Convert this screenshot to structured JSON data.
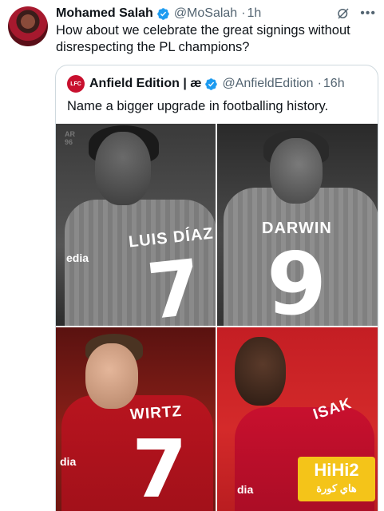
{
  "tweet": {
    "author_name": "Mohamed Salah",
    "handle": "@MoSalah",
    "separator": "·",
    "time": "1h",
    "text": "How about we celebrate the great signings without disrespecting the PL champions?",
    "icons": [
      "verified-badge-icon",
      "grok-icon",
      "more-options-icon"
    ],
    "more_options_glyph": "•••"
  },
  "quote": {
    "avatar_text": "LFC",
    "author_name": "Anfield Edition | æ",
    "handle": "@AnfieldEdition",
    "separator": "·",
    "time": "16h",
    "text": "Name a bigger upgrade in footballing history.",
    "image": {
      "corner_mark": "AR\n96",
      "panels": [
        {
          "player_name": "LUIS DÍAZ",
          "number": "7",
          "sponsor": "edia"
        },
        {
          "player_name": "DARWIN",
          "number": "9",
          "sponsor": ""
        },
        {
          "player_name": "WIRTZ",
          "number": "7",
          "sponsor": "dia"
        },
        {
          "player_name": "ISAK",
          "number": "",
          "sponsor": "dia"
        }
      ]
    }
  },
  "watermark": {
    "main": "HiHi2",
    "sub": "هاي كورة"
  },
  "colors": {
    "verified": "#1d9bf0",
    "text_primary": "#0f1419",
    "text_secondary": "#536471",
    "liverpool_red": "#c8102e",
    "watermark_yellow": "#f4c419"
  }
}
